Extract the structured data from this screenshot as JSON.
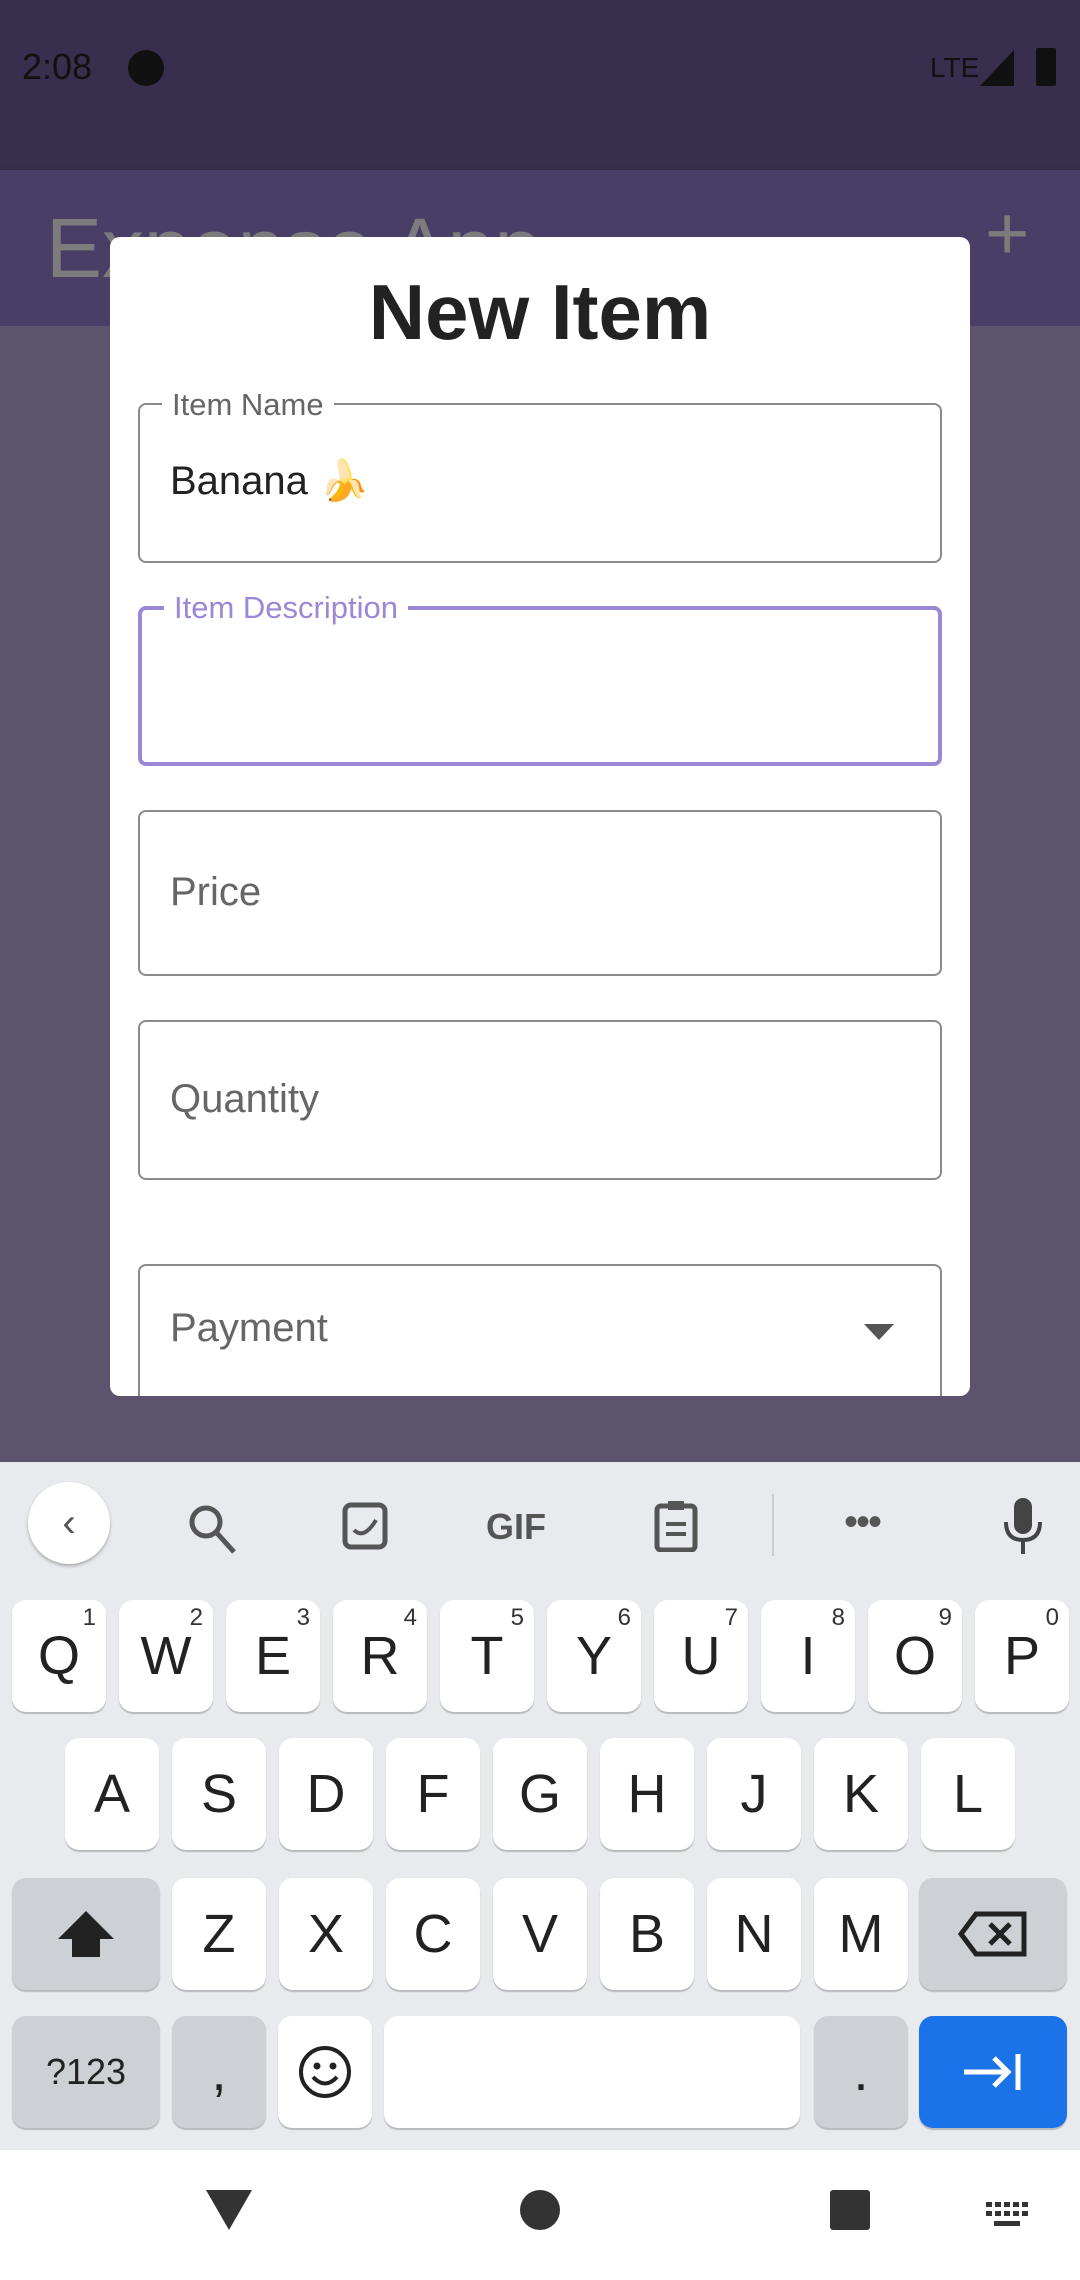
{
  "status_bar": {
    "time": "2:08",
    "network": "LTE"
  },
  "app_bar": {
    "title": "Expense App",
    "add_icon": "plus-icon"
  },
  "dialog": {
    "title": "New Item",
    "fields": [
      {
        "label": "Item Name",
        "value": "Banana 🍌"
      },
      {
        "label": "Item Description",
        "value": ""
      },
      {
        "placeholder": "Price"
      },
      {
        "placeholder": "Quantity"
      },
      {
        "placeholder": "Payment"
      }
    ]
  },
  "keyboard": {
    "toolbar": {
      "gif": "GIF"
    },
    "row1": [
      [
        "Q",
        "1"
      ],
      [
        "W",
        "2"
      ],
      [
        "E",
        "3"
      ],
      [
        "R",
        "4"
      ],
      [
        "T",
        "5"
      ],
      [
        "Y",
        "6"
      ],
      [
        "U",
        "7"
      ],
      [
        "I",
        "8"
      ],
      [
        "O",
        "9"
      ],
      [
        "P",
        "0"
      ]
    ],
    "row2": [
      "A",
      "S",
      "D",
      "F",
      "G",
      "H",
      "J",
      "K",
      "L"
    ],
    "row3": [
      "Z",
      "X",
      "C",
      "V",
      "B",
      "N",
      "M"
    ],
    "symbols": "?123",
    "comma": ",",
    "period": ".",
    "accent": "#1a73e8"
  }
}
